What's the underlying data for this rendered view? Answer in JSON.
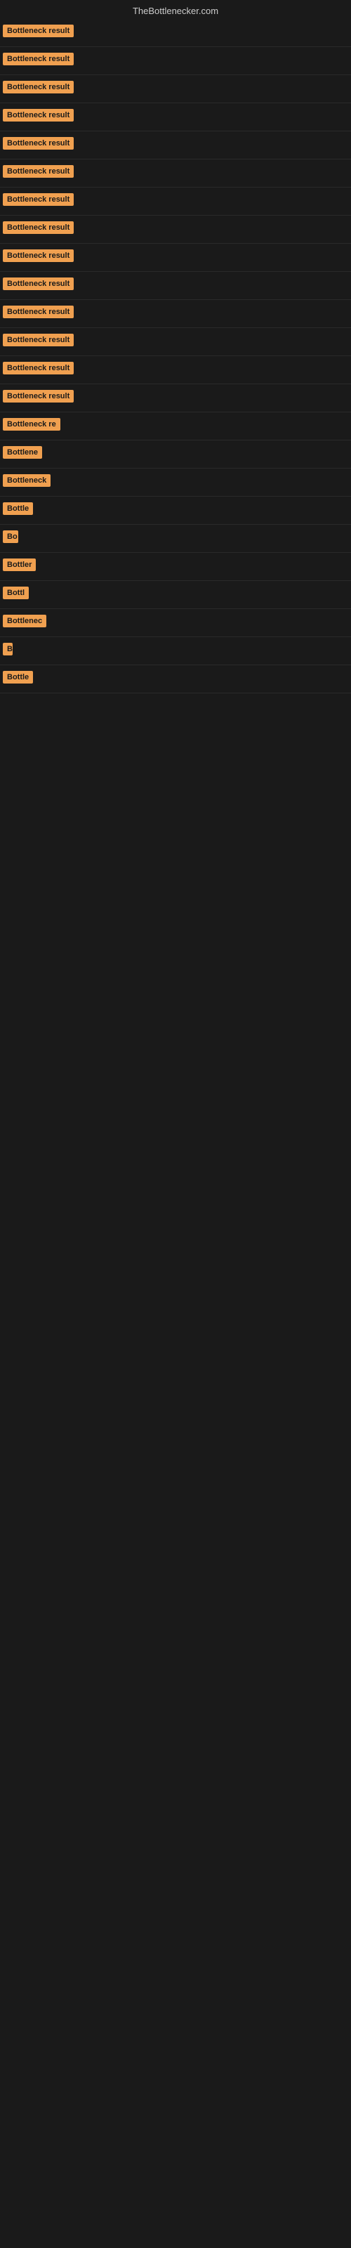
{
  "site": {
    "title": "TheBottlenecker.com"
  },
  "results": [
    {
      "id": 1,
      "label": "Bottleneck result",
      "width": 115
    },
    {
      "id": 2,
      "label": "Bottleneck result",
      "width": 115
    },
    {
      "id": 3,
      "label": "Bottleneck result",
      "width": 115
    },
    {
      "id": 4,
      "label": "Bottleneck result",
      "width": 115
    },
    {
      "id": 5,
      "label": "Bottleneck result",
      "width": 115
    },
    {
      "id": 6,
      "label": "Bottleneck result",
      "width": 115
    },
    {
      "id": 7,
      "label": "Bottleneck result",
      "width": 115
    },
    {
      "id": 8,
      "label": "Bottleneck result",
      "width": 115
    },
    {
      "id": 9,
      "label": "Bottleneck result",
      "width": 115
    },
    {
      "id": 10,
      "label": "Bottleneck result",
      "width": 115
    },
    {
      "id": 11,
      "label": "Bottleneck result",
      "width": 115
    },
    {
      "id": 12,
      "label": "Bottleneck result",
      "width": 115
    },
    {
      "id": 13,
      "label": "Bottleneck result",
      "width": 115
    },
    {
      "id": 14,
      "label": "Bottleneck result",
      "width": 115
    },
    {
      "id": 15,
      "label": "Bottleneck re",
      "width": 88
    },
    {
      "id": 16,
      "label": "Bottlene",
      "width": 60
    },
    {
      "id": 17,
      "label": "Bottleneck",
      "width": 70
    },
    {
      "id": 18,
      "label": "Bottle",
      "width": 50
    },
    {
      "id": 19,
      "label": "Bo",
      "width": 22
    },
    {
      "id": 20,
      "label": "Bottler",
      "width": 52
    },
    {
      "id": 21,
      "label": "Bottl",
      "width": 38
    },
    {
      "id": 22,
      "label": "Bottlenec",
      "width": 68
    },
    {
      "id": 23,
      "label": "B",
      "width": 14
    },
    {
      "id": 24,
      "label": "Bottle",
      "width": 50
    }
  ]
}
